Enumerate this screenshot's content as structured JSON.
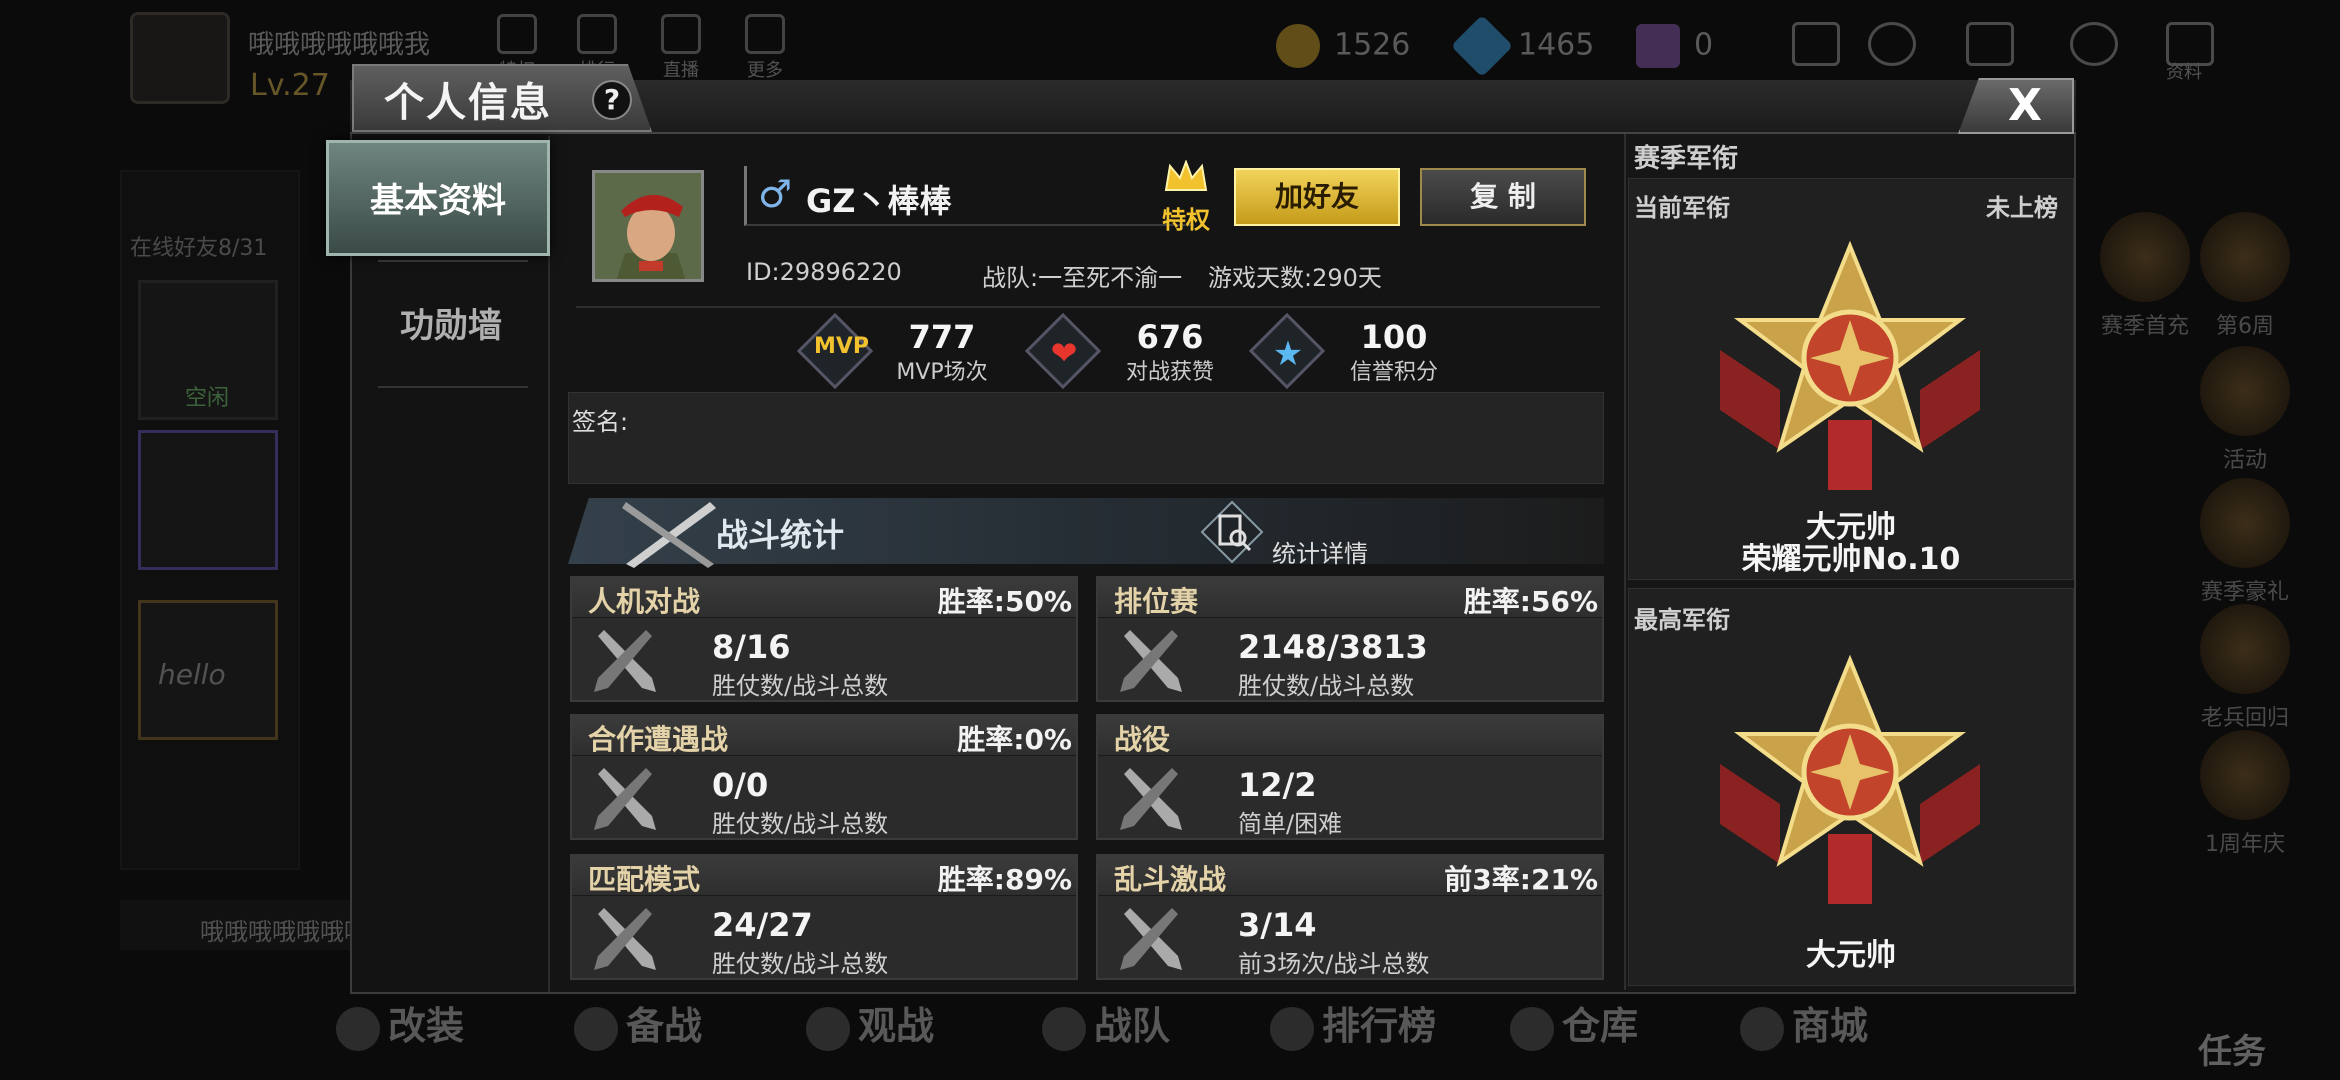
{
  "background": {
    "player_name": "哦哦哦哦哦哦我",
    "level": "Lv.27",
    "nav": [
      "特权",
      "排行",
      "直播",
      "更多"
    ],
    "coins": "1526",
    "diamonds": "1465",
    "tickets": "0",
    "resource_label": "资料",
    "online_friends": "在线好友8/31",
    "friend_name": "空闲",
    "hello_text": "hello",
    "chat_text": "哦哦哦哦哦哦哦",
    "side_items": [
      "赛季首充",
      "第6周",
      "活动",
      "赛季豪礼",
      "老兵回归",
      "1周年庆"
    ],
    "bottom_nav": [
      "改装",
      "备战",
      "观战",
      "战队",
      "排行榜",
      "仓库",
      "商城"
    ],
    "task_label": "任务"
  },
  "dialog": {
    "title": "个人信息",
    "help": "?",
    "close": "X",
    "tabs": {
      "basic": "基本资料",
      "merit": "功勋墙"
    }
  },
  "profile": {
    "gender_symbol": "♂",
    "name": "GZ丶棒棒",
    "privilege": "特权",
    "add_friend": "加好友",
    "copy": "复 制",
    "id": "ID:29896220",
    "team": "战队:一至死不渝一",
    "days": "游戏天数:290天",
    "stats": [
      {
        "icon": "MVP",
        "value": "777",
        "label": "MVP场次"
      },
      {
        "icon": "❤",
        "value": "676",
        "label": "对战获赞"
      },
      {
        "icon": "★",
        "value": "100",
        "label": "信誉积分"
      }
    ],
    "signature_label": "签名:"
  },
  "battle": {
    "title": "战斗统计",
    "detail": "统计详情",
    "cards": [
      {
        "mode": "人机对战",
        "rate": "胜率:50%",
        "value": "8/16",
        "sub": "胜仗数/战斗总数"
      },
      {
        "mode": "排位赛",
        "rate": "胜率:56%",
        "value": "2148/3813",
        "sub": "胜仗数/战斗总数"
      },
      {
        "mode": "合作遭遇战",
        "rate": "胜率:0%",
        "value": "0/0",
        "sub": "胜仗数/战斗总数"
      },
      {
        "mode": "战役",
        "rate": "",
        "value": "12/2",
        "sub": "简单/困难"
      },
      {
        "mode": "匹配模式",
        "rate": "胜率:89%",
        "value": "24/27",
        "sub": "胜仗数/战斗总数"
      },
      {
        "mode": "乱斗激战",
        "rate": "前3率:21%",
        "value": "3/14",
        "sub": "前3场次/战斗总数"
      }
    ]
  },
  "season": {
    "title": "赛季军衔",
    "current_label": "当前军衔",
    "unranked": "未上榜",
    "current_rank": "大元帅",
    "current_rank_sub": "荣耀元帅No.10",
    "highest_label": "最高军衔",
    "highest_rank": "大元帅"
  },
  "colors": {
    "accent_gold": "#f2d35a",
    "tab_active": "#6f8580",
    "privilege": "#f2c22e"
  }
}
